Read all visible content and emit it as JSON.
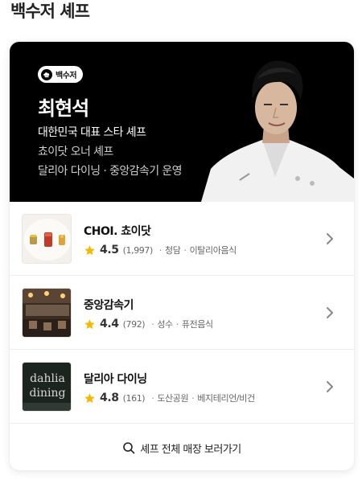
{
  "section": {
    "title": "백수저 셰프"
  },
  "chef": {
    "badge": "백수저",
    "name": "최현석",
    "headline": "대한민국 대표 스타 셰프",
    "role": "쵸이닷 오너 셰프",
    "also": "달리아 다이닝 · 중앙감속기 운영"
  },
  "restaurants": [
    {
      "name": "CHOI. 쵸이닷",
      "rating": "4.5",
      "reviews": "(1,997)",
      "area": "청담",
      "cuisine": "이탈리아음식",
      "thumb": "plated-dish-photo"
    },
    {
      "name": "중앙감속기",
      "rating": "4.4",
      "reviews": "(792)",
      "area": "성수",
      "cuisine": "퓨전음식",
      "thumb": "restaurant-interior-photo"
    },
    {
      "name": "달리아 다이닝",
      "rating": "4.8",
      "reviews": "(161)",
      "area": "도산공원",
      "cuisine": "베지테리언/비건",
      "thumb": "dahlia-dining-sign-photo",
      "thumb_text": [
        "dahlia",
        "dining"
      ]
    }
  ],
  "footer": {
    "label": "셰프 전체 매장 보러가기",
    "icon": "search-icon"
  },
  "colors": {
    "star": "#f5b800",
    "hero_bg": "#000000"
  }
}
